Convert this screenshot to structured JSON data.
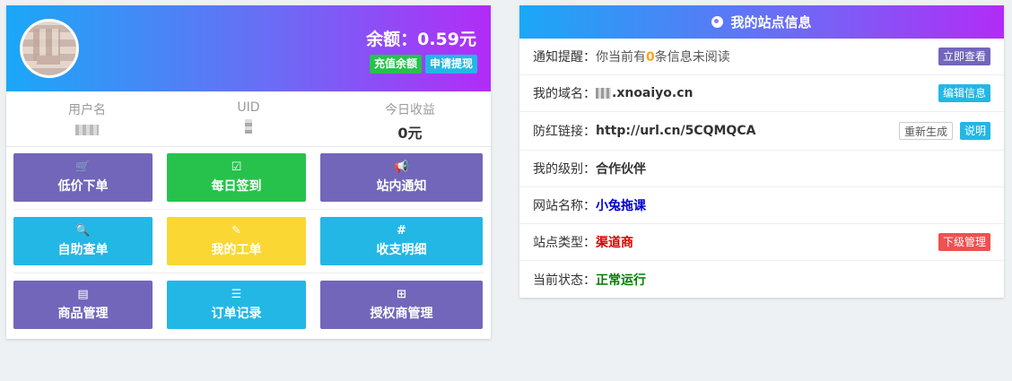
{
  "profile": {
    "balance_label": "余额：0.59元",
    "recharge_label": "充值余额",
    "withdraw_label": "申请提现"
  },
  "stats": [
    {
      "label": "用户名",
      "value": ""
    },
    {
      "label": "UID",
      "value": ""
    },
    {
      "label": "今日收益",
      "value": "0元"
    }
  ],
  "actions": [
    {
      "label": "低价下单",
      "icon": "cart-icon",
      "glyph": "🛒"
    },
    {
      "label": "每日签到",
      "icon": "check-square-icon",
      "glyph": "☑"
    },
    {
      "label": "站内通知",
      "icon": "bullhorn-icon",
      "glyph": "📢"
    },
    {
      "label": "自助查单",
      "icon": "search-icon",
      "glyph": "🔍"
    },
    {
      "label": "我的工单",
      "icon": "edit-icon",
      "glyph": "✎"
    },
    {
      "label": "收支明细",
      "icon": "hashtag-icon",
      "glyph": "#"
    },
    {
      "label": "商品管理",
      "icon": "list-alt-icon",
      "glyph": "▤"
    },
    {
      "label": "订单记录",
      "icon": "list-icon",
      "glyph": "☰"
    },
    {
      "label": "授权商管理",
      "icon": "sitemap-icon",
      "glyph": "⊞"
    }
  ],
  "site": {
    "title": "我的站点信息",
    "notice_label": "通知提醒：",
    "notice_prefix": "你当前有",
    "notice_count": "0",
    "notice_suffix": "条信息未阅读",
    "notice_btn": "立即查看",
    "domain_label": "我的域名：",
    "domain_value": ".xnoaiyo.cn",
    "domain_btn": "编辑信息",
    "link_label": "防红链接：",
    "link_value": "http://url.cn/5CQMQCA",
    "regen_btn": "重新生成",
    "explain_btn": "说明",
    "level_label": "我的级别：",
    "level_value": "合作伙伴",
    "name_label": "网站名称：",
    "name_value": "小兔拖课",
    "type_label": "站点类型：",
    "type_value": "渠道商",
    "type_btn": "下级管理",
    "status_label": "当前状态：",
    "status_value": "正常运行"
  },
  "colors": {
    "purple": "#7266ba",
    "green": "#27c24c",
    "cyan": "#23b7e5",
    "yellow": "#fad733",
    "red": "#f05050",
    "gradient_start": "#1aa8f7",
    "gradient_end": "#b22cf7"
  }
}
